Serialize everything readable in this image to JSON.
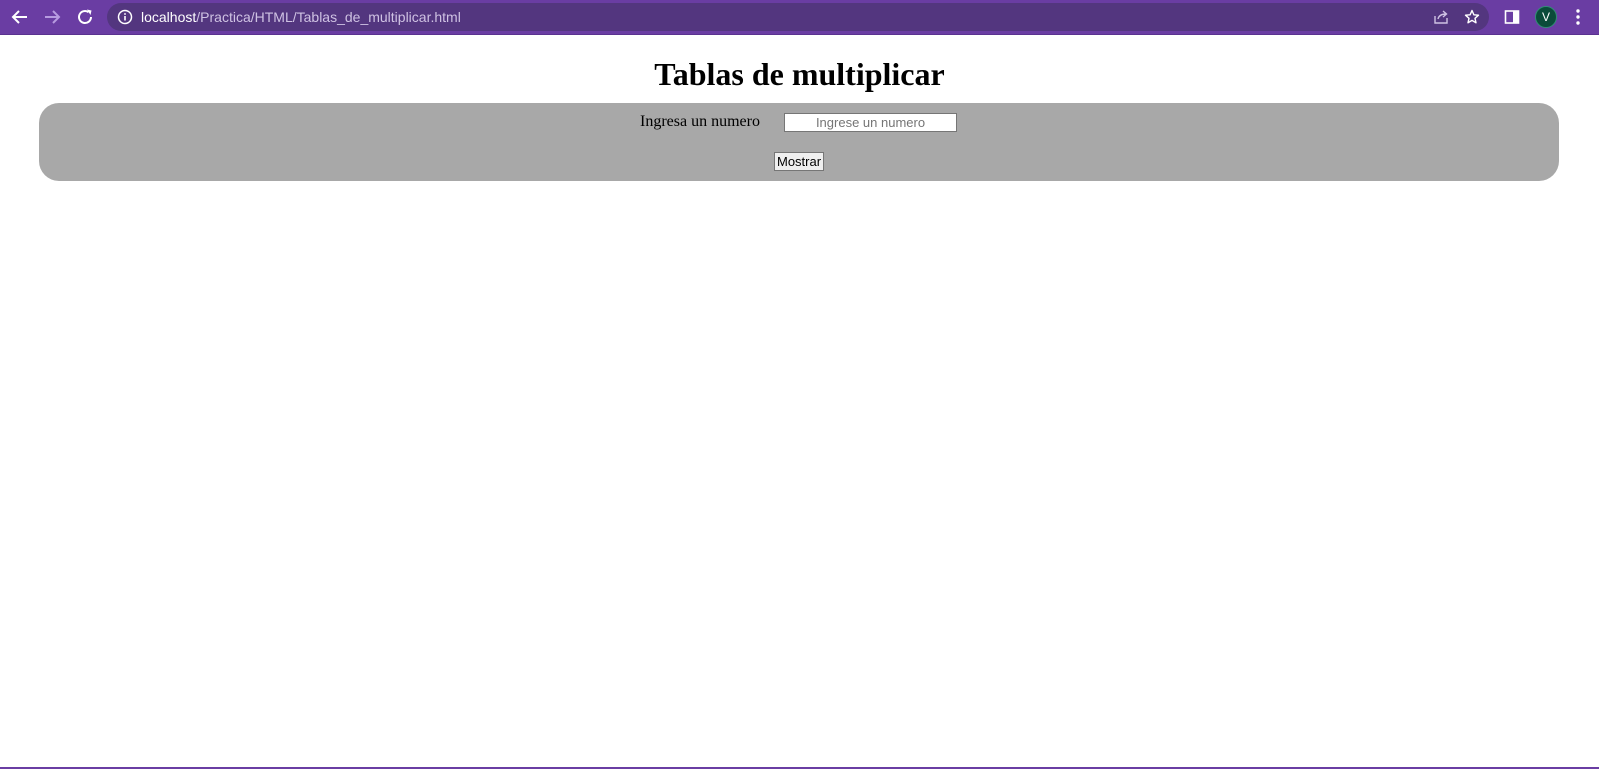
{
  "browser": {
    "url_host": "localhost",
    "url_path": "/Practica/HTML/Tablas_de_multiplicar.html",
    "profile_initial": "V",
    "theme_color": "#6a3da3",
    "omnibox_color": "#53367f",
    "profile_color": "#0b4b3a",
    "icons": [
      "back-arrow-icon",
      "forward-arrow-icon",
      "reload-icon",
      "site-info-icon",
      "share-icon",
      "bookmark-star-icon",
      "side-panel-icon",
      "kebab-menu-icon"
    ]
  },
  "page": {
    "title": "Tablas de multiplicar",
    "form": {
      "label": "Ingresa un numero",
      "input_value": "",
      "input_placeholder": "Ingrese un numero",
      "button_label": "Mostrar",
      "panel_color": "#a8a8a8"
    }
  }
}
